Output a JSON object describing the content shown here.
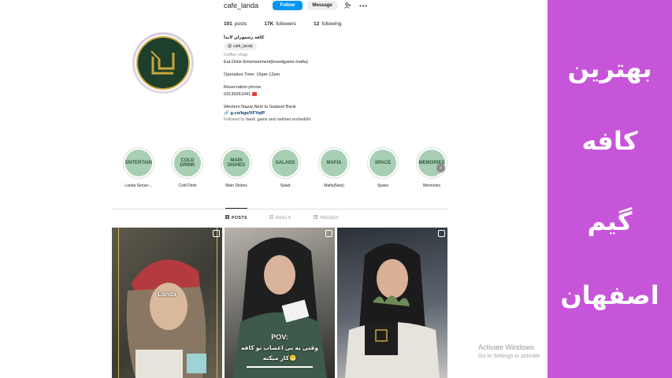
{
  "profile": {
    "username": "cafe_landa",
    "follow_label": "Follow",
    "message_label": "Message",
    "posts_count": "101",
    "posts_label": "posts",
    "followers_count": "17K",
    "followers_label": "followers",
    "following_count": "12",
    "following_label": "following"
  },
  "bio": {
    "name": "کافه رستوران لاندا",
    "threads_handle": "cafe_landa",
    "category": "Coffee shop",
    "line1": "Eat Drink Entertainment(boardgame-mafia)",
    "dot1": ".",
    "line2": "Operation Time: 16pm-12am",
    "dot2": ".",
    "line3": "Reservation phone:",
    "line4": "03136261041",
    "dot3": ".",
    "line5": "Western Nazar,Next to Sadaret Bank",
    "link": "g.co/kgs/VFYqtP",
    "followed_by_prefix": "Followed by ",
    "followed_by_names": "hanil_game and radman.ershadiiiii"
  },
  "highlights": [
    {
      "label": "Landa Sense-...",
      "inner": "ENTERTAIN"
    },
    {
      "label": "Cold Drink",
      "inner": "COLD DRINK"
    },
    {
      "label": "Main Dishes",
      "inner": "MAIN DISHES"
    },
    {
      "label": "Salad",
      "inner": "SALADS"
    },
    {
      "label": "Mafia(New)",
      "inner": "MAFIA"
    },
    {
      "label": "Space",
      "inner": "SPACE"
    },
    {
      "label": "Memories",
      "inner": "MEMORIES"
    }
  ],
  "tabs": {
    "posts": "POSTS",
    "reels": "REELS",
    "tagged": "TAGGED"
  },
  "posts": {
    "p1_logo": "Landa",
    "p2_title": "POV:",
    "p2_line1": "وقتی یه بی اعصاب تو کافه",
    "p2_line2": "کار میکنه😬"
  },
  "watermark": {
    "title": "Activate Windows",
    "subtitle": "Go to Settings to activate"
  },
  "panel": {
    "line1": "بهترین",
    "line2": "کافه",
    "line3": "گیم",
    "line4": "اصفهان"
  },
  "colors": {
    "follow_button": "#0095f6",
    "panel_bg": "#c755d9",
    "highlight_bg": "#a8cfb3",
    "logo_green": "#1d3f2c",
    "logo_gold": "#c9a63c"
  }
}
